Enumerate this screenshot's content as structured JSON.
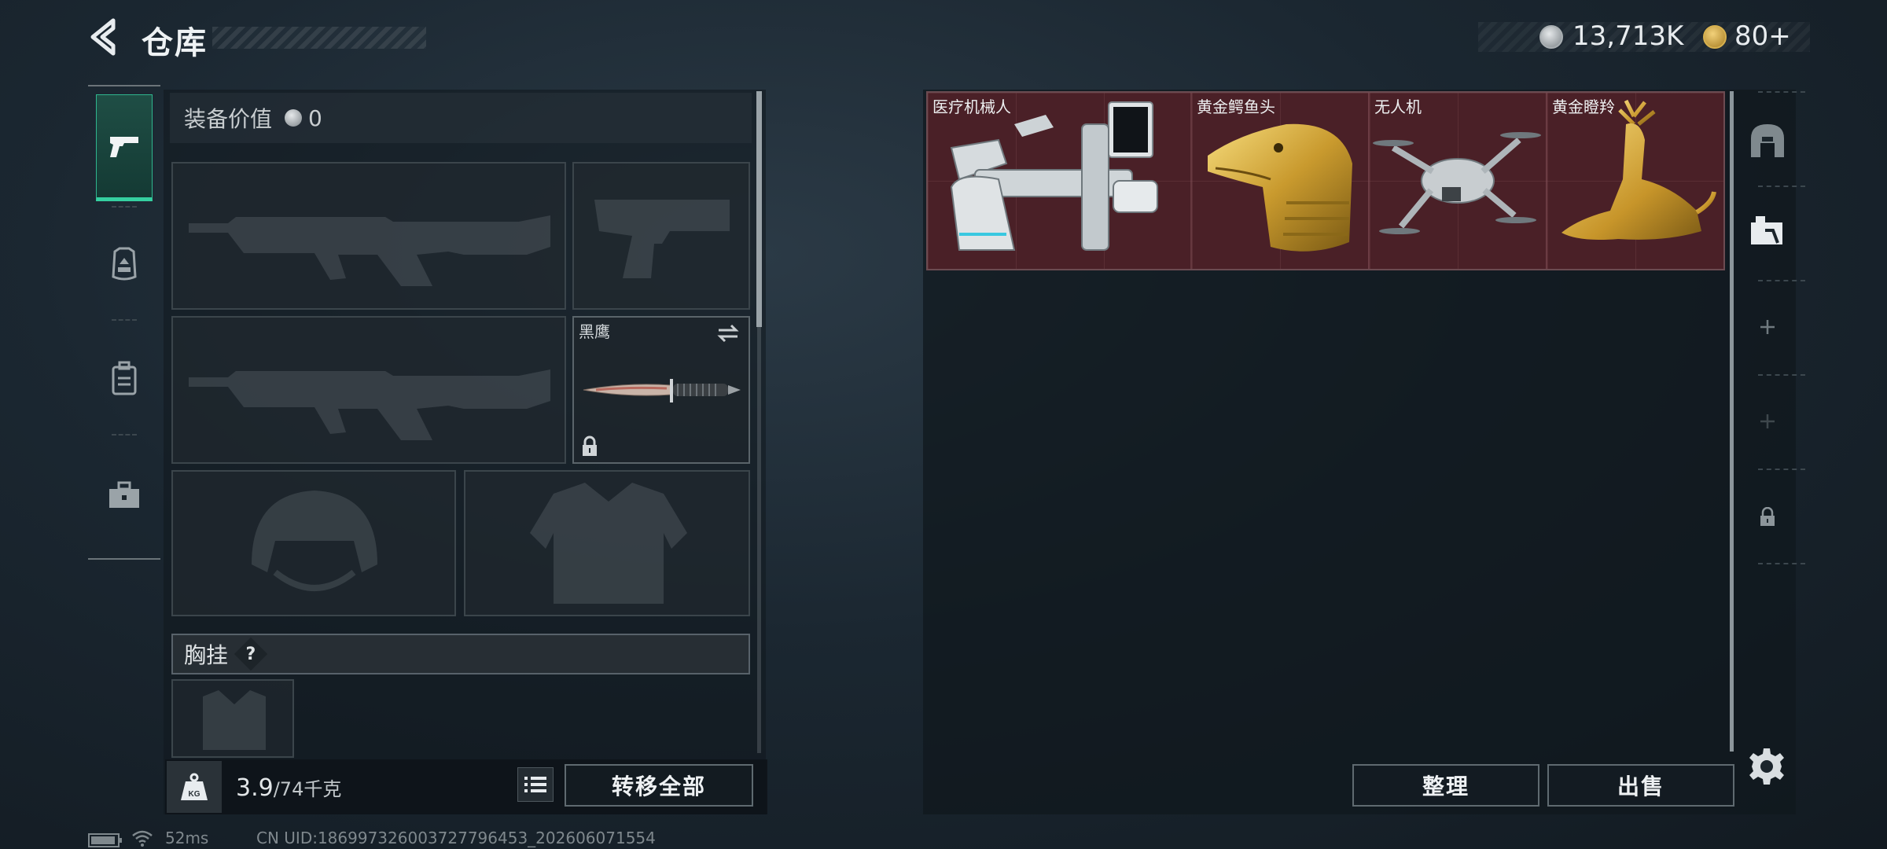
{
  "header": {
    "title": "仓库",
    "silver_amount": "13,713K",
    "gold_amount": "80+"
  },
  "left_tabs": [
    {
      "name": "weapons",
      "icon": "pistol-icon",
      "active": true
    },
    {
      "name": "armor",
      "icon": "rig-icon",
      "active": false
    },
    {
      "name": "backpack",
      "icon": "backpack-icon",
      "active": false
    },
    {
      "name": "case",
      "icon": "toolbox-icon",
      "active": false
    }
  ],
  "equipment": {
    "value_label": "装备价值",
    "value": "0",
    "knife_name": "黑鹰",
    "chest_rig_label": "胸挂",
    "help": "?"
  },
  "footer_left": {
    "weight_value": "3.9",
    "weight_limit": "/74千克",
    "transfer_all": "转移全部"
  },
  "inventory_items": [
    {
      "name": "医疗机械人"
    },
    {
      "name": "黄金鳄鱼头"
    },
    {
      "name": "无人机"
    },
    {
      "name": "黄金瞪羚"
    }
  ],
  "right_actions": {
    "sort": "整理",
    "sell": "出售"
  },
  "status_bar": {
    "ping": "52ms",
    "uid": "CN UID:186997326003727796453_202606071554"
  }
}
